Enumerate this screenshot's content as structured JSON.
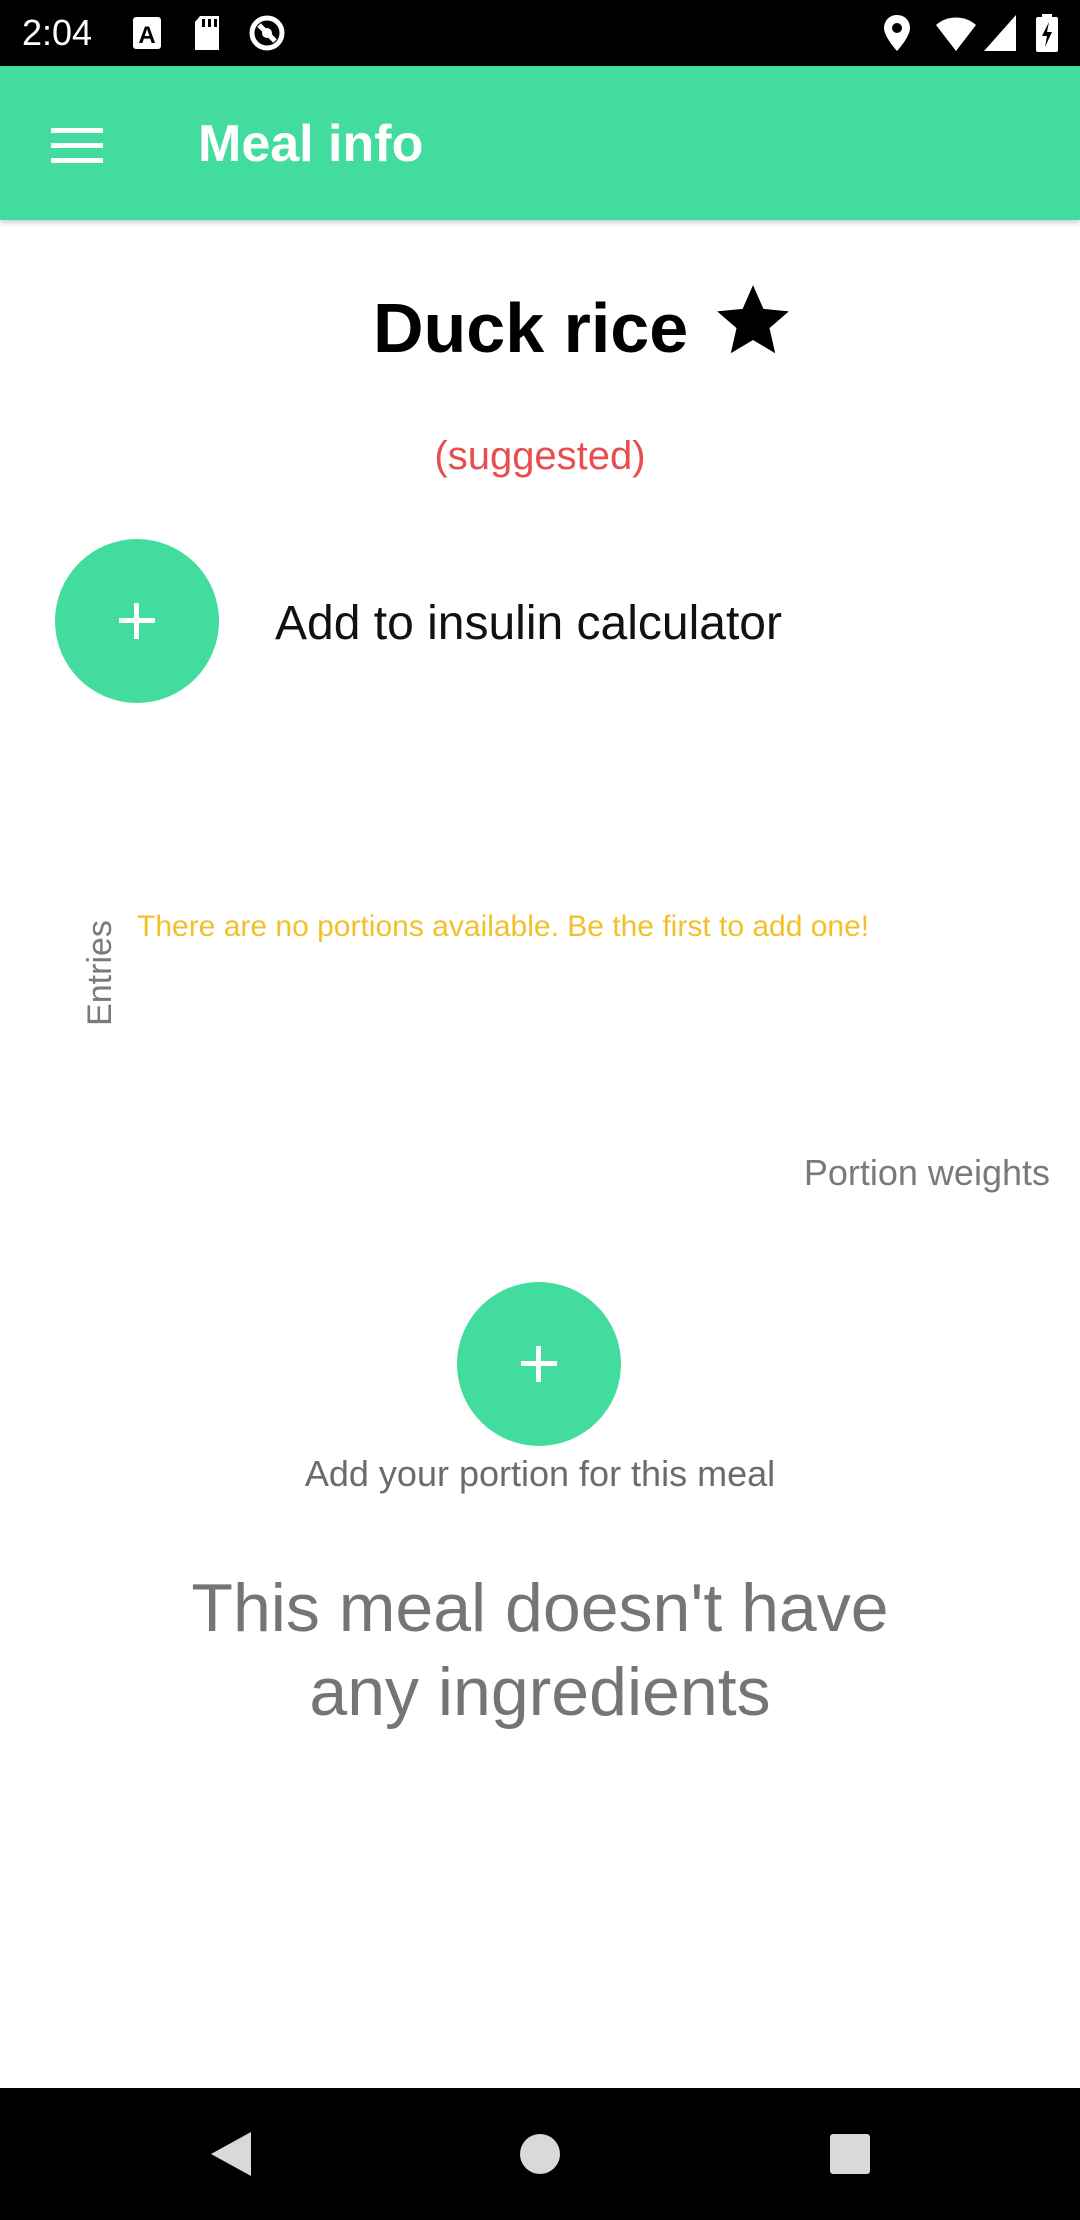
{
  "status_bar": {
    "time": "2:04",
    "icons": [
      "a-notification-icon",
      "sd-card-icon",
      "sync-icon",
      "location-icon",
      "wifi-icon",
      "signal-icon",
      "battery-icon"
    ]
  },
  "app_bar": {
    "title": "Meal info",
    "background_color": "#43DC9F",
    "menu_icon": "hamburger-menu-icon"
  },
  "meal": {
    "name": "Duck rice",
    "favorite_icon": "star-icon",
    "status": "(suggested)",
    "status_color": "#E84E4F",
    "add_calculator_label": "Add to insulin calculator"
  },
  "entries": {
    "label": "Entries",
    "empty_message": "There are no portions available. Be the first to add one!",
    "empty_color": "#F2C02B"
  },
  "portions": {
    "header": "Portion weights",
    "add_label": "Add your portion for this meal"
  },
  "ingredients": {
    "empty_message_line1": "This meal doesn't have",
    "empty_message_line2": "any ingredients"
  },
  "nav_bar": {
    "icons": [
      "back-icon",
      "home-icon",
      "recents-icon"
    ]
  }
}
